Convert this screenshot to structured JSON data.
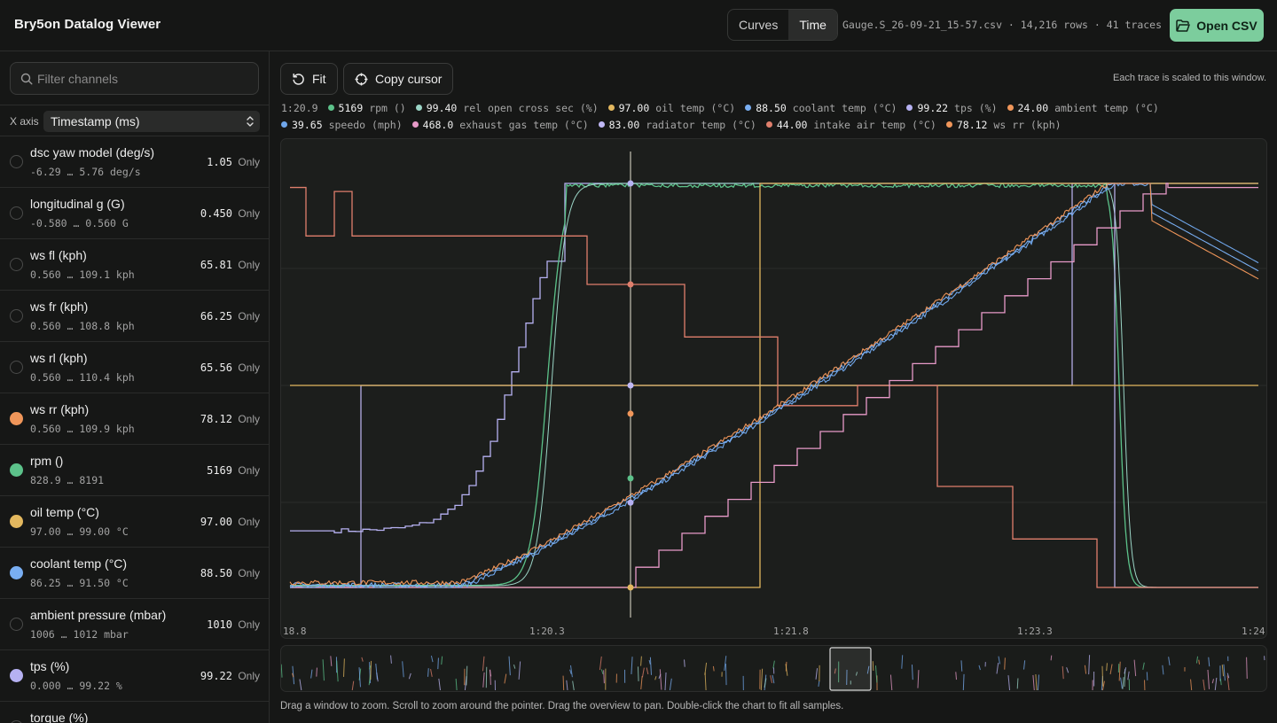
{
  "app": {
    "title": "Bry5on Datalog Viewer"
  },
  "header": {
    "view_modes": [
      "Curves",
      "Time"
    ],
    "active_mode": "Time",
    "file_info": "Gauge.S_26-09-21_15-57.csv · 14,216 rows · 41 traces",
    "open_label": "Open CSV"
  },
  "sidebar": {
    "filter_placeholder": "Filter channels",
    "x_axis_label": "X axis",
    "x_axis_value": "Timestamp (ms)",
    "only_label": "Only",
    "channels": [
      {
        "name": "dsc yaw model (deg/s)",
        "range": "-6.29 … 5.76 deg/s",
        "value": "1.05",
        "color": ""
      },
      {
        "name": "longitudinal g (G)",
        "range": "-0.580 … 0.560 G",
        "value": "0.450",
        "color": ""
      },
      {
        "name": "ws fl (kph)",
        "range": "0.560 … 109.1 kph",
        "value": "65.81",
        "color": ""
      },
      {
        "name": "ws fr (kph)",
        "range": "0.560 … 108.8 kph",
        "value": "66.25",
        "color": ""
      },
      {
        "name": "ws rl (kph)",
        "range": "0.560 … 110.4 kph",
        "value": "65.56",
        "color": ""
      },
      {
        "name": "ws rr (kph)",
        "range": "0.560 … 109.9 kph",
        "value": "78.12",
        "color": "#f0965a"
      },
      {
        "name": "rpm ()",
        "range": "828.9 … 8191",
        "value": "5169",
        "color": "#5cc28a"
      },
      {
        "name": "oil temp (°C)",
        "range": "97.00 … 99.00 °C",
        "value": "97.00",
        "color": "#e3b85f"
      },
      {
        "name": "coolant temp (°C)",
        "range": "86.25 … 91.50 °C",
        "value": "88.50",
        "color": "#79aef2"
      },
      {
        "name": "ambient pressure (mbar)",
        "range": "1006 … 1012 mbar",
        "value": "1010",
        "color": ""
      },
      {
        "name": "tps (%)",
        "range": "0.000 … 99.22 %",
        "value": "99.22",
        "color": "#b6b1f2"
      },
      {
        "name": "torque (%)",
        "range": "",
        "value": "",
        "color": ""
      }
    ]
  },
  "toolbar": {
    "fit_label": "Fit",
    "copy_label": "Copy cursor",
    "scale_hint": "Each trace is scaled to this window."
  },
  "cursor": {
    "time": "1:20.9",
    "readouts": [
      {
        "value": "5169",
        "label": "rpm ()",
        "color": "#5cc28a"
      },
      {
        "value": "99.40",
        "label": "rel open cross sec (%)",
        "color": "#9bd5c6"
      },
      {
        "value": "97.00",
        "label": "oil temp (°C)",
        "color": "#e3b85f"
      },
      {
        "value": "88.50",
        "label": "coolant temp (°C)",
        "color": "#79aef2"
      },
      {
        "value": "99.22",
        "label": "tps (%)",
        "color": "#b6b1f2"
      },
      {
        "value": "24.00",
        "label": "ambient temp (°C)",
        "color": "#f0965a"
      },
      {
        "value": "39.65",
        "label": "speedo (mph)",
        "color": "#6fa6ea"
      },
      {
        "value": "468.0",
        "label": "exhaust gas temp (°C)",
        "color": "#e79ac8"
      },
      {
        "value": "83.00",
        "label": "radiator temp (°C)",
        "color": "#c0b8f5"
      },
      {
        "value": "44.00",
        "label": "intake air temp (°C)",
        "color": "#e07f6c"
      },
      {
        "value": "78.12",
        "label": "ws rr (kph)",
        "color": "#f0965a"
      }
    ]
  },
  "chart_data": {
    "type": "line",
    "x_ticks": [
      "18.8",
      "1:20.3",
      "1:21.8",
      "1:23.3",
      "1:24"
    ],
    "grid": true,
    "cursor_x": "1:20.9",
    "series": [
      {
        "name": "ws rr (kph)",
        "color": "#f0965a"
      },
      {
        "name": "rpm ()",
        "color": "#5cc28a"
      },
      {
        "name": "oil temp (°C)",
        "color": "#e3b85f"
      },
      {
        "name": "coolant temp (°C)",
        "color": "#79aef2"
      },
      {
        "name": "tps (%)",
        "color": "#b6b1f2"
      },
      {
        "name": "speedo (mph)",
        "color": "#6fa6ea"
      },
      {
        "name": "exhaust gas temp (°C)",
        "color": "#e79ac8"
      },
      {
        "name": "radiator temp (°C)",
        "color": "#c0b8f5"
      },
      {
        "name": "intake air temp (°C)",
        "color": "#e07f6c"
      },
      {
        "name": "rel open cross sec (%)",
        "color": "#9bd5c6"
      }
    ]
  },
  "footer": {
    "hint": "Drag a window to zoom. Scroll to zoom around the pointer. Drag the overview to pan. Double-click the chart to fit all samples."
  }
}
